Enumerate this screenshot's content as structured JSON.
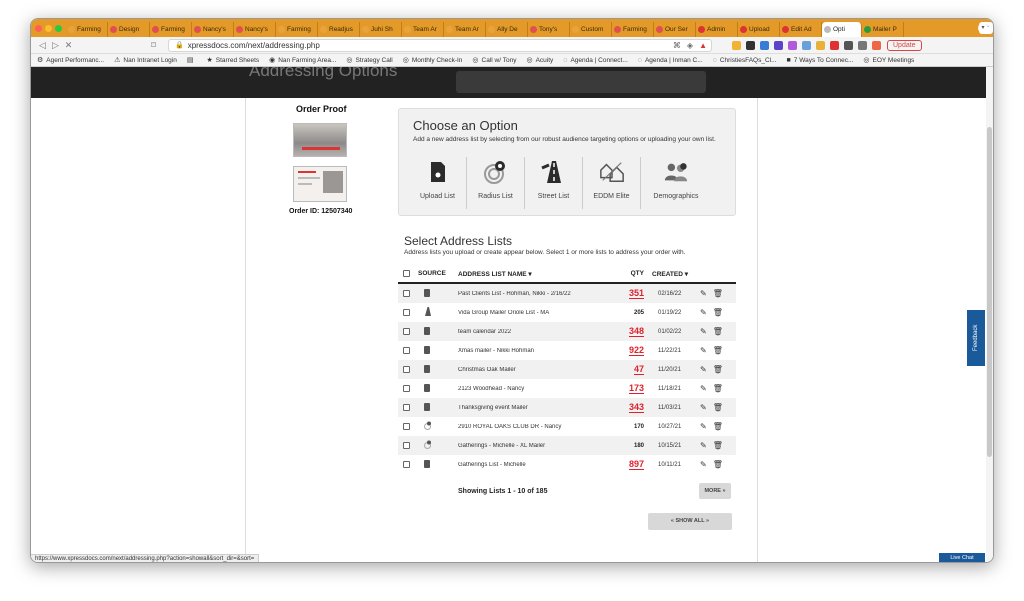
{
  "browser": {
    "tabs": [
      {
        "label": "Farming",
        "color": "#e8a33a"
      },
      {
        "label": "Design",
        "color": "#e05050"
      },
      {
        "label": "Farming",
        "color": "#e05050"
      },
      {
        "label": "Nancy's",
        "color": "#e05050"
      },
      {
        "label": "Nancy's",
        "color": "#e05050"
      },
      {
        "label": "Farming",
        "color": "#e8a33a"
      },
      {
        "label": "Readjus",
        "color": "#e8a33a"
      },
      {
        "label": "Juhi Sh",
        "color": "#e8a33a"
      },
      {
        "label": "Team Ar",
        "color": "#e8a33a"
      },
      {
        "label": "Team Ar",
        "color": "#e8a33a"
      },
      {
        "label": "Ally De",
        "color": "#e8a33a"
      },
      {
        "label": "Tony's",
        "color": "#e05050"
      },
      {
        "label": "Custom",
        "color": "#e8a33a"
      },
      {
        "label": "Farming",
        "color": "#e05050"
      },
      {
        "label": "Our Ser",
        "color": "#e05050"
      },
      {
        "label": "Admin",
        "color": "#d33"
      },
      {
        "label": "Upload",
        "color": "#d33"
      },
      {
        "label": "Edit Ad",
        "color": "#d33"
      },
      {
        "label": "Opti",
        "color": "#bbb"
      },
      {
        "label": "Mailer P",
        "color": "#2a9a3a"
      }
    ],
    "url": "xpressdocs.com/next/addressing.php",
    "update_label": "Update",
    "bookmarks": [
      {
        "label": "Agent Performanc...",
        "icon": "⚙"
      },
      {
        "label": "Nan Intranet Login",
        "icon": "⚠"
      },
      {
        "label": "",
        "icon": "▤"
      },
      {
        "label": "Starred Sheets",
        "icon": "★"
      },
      {
        "label": "Nan Farming Area...",
        "icon": "◉"
      },
      {
        "label": "Strategy Call",
        "icon": "◎"
      },
      {
        "label": "Monthly Check-In",
        "icon": "◎"
      },
      {
        "label": "Call w/ Tony",
        "icon": "◎"
      },
      {
        "label": "Acuity",
        "icon": "◎"
      },
      {
        "label": "Agenda | Connect...",
        "icon": "◌"
      },
      {
        "label": "Agenda | Inman C...",
        "icon": "◌"
      },
      {
        "label": "ChristiesFAQs_Cl...",
        "icon": "◌"
      },
      {
        "label": "7 Ways To Connec...",
        "icon": "■"
      },
      {
        "label": "EOY Meetings",
        "icon": "◎"
      }
    ]
  },
  "header": {
    "title": "Addressing Options"
  },
  "proof": {
    "title": "Order Proof",
    "order_id": "Order ID: 12507340"
  },
  "options": {
    "title": "Choose an Option",
    "subtitle": "Add a new address list by selecting from our robust audience targeting options or uploading your own list.",
    "items": [
      {
        "label": "Upload List",
        "icon": "upload-doc-icon"
      },
      {
        "label": "Radius List",
        "icon": "radius-target-icon"
      },
      {
        "label": "Street List",
        "icon": "street-road-icon"
      },
      {
        "label": "EDDM Elite",
        "icon": "eddm-houses-icon"
      },
      {
        "label": "Demographics",
        "icon": "demographics-people-icon"
      }
    ]
  },
  "lists": {
    "title": "Select Address Lists",
    "subtitle": "Address lists you upload or create appear below. Select 1 or more lists to address your order with.",
    "columns": {
      "source": "SOURCE",
      "name": "ADDRESS LIST NAME ▾",
      "qty": "QTY",
      "created": "CREATED ▾"
    },
    "rows": [
      {
        "source": "upload",
        "name": "Past Clients List - Hohman, Nikki - 2/16/22",
        "qty": "351",
        "qty_link": true,
        "created": "02/16/22"
      },
      {
        "source": "street",
        "name": "Vida Group Mailer Oriole List - MA",
        "qty": "205",
        "qty_link": false,
        "created": "01/19/22"
      },
      {
        "source": "upload",
        "name": "team calendar 2022",
        "qty": "348",
        "qty_link": true,
        "created": "01/02/22"
      },
      {
        "source": "upload",
        "name": "Xmas mailer - Nikki Hohman",
        "qty": "922",
        "qty_link": true,
        "created": "11/22/21"
      },
      {
        "source": "upload",
        "name": "Christmas Oak Mailer",
        "qty": "47",
        "qty_link": true,
        "created": "11/20/21"
      },
      {
        "source": "upload",
        "name": "2123 Woodhead - Nancy",
        "qty": "173",
        "qty_link": true,
        "created": "11/18/21"
      },
      {
        "source": "upload",
        "name": "Thanksgiving event Mailer",
        "qty": "343",
        "qty_link": true,
        "created": "11/03/21"
      },
      {
        "source": "radius",
        "name": "2910 ROYAL OAKS CLUB DR - Nancy",
        "qty": "170",
        "qty_link": false,
        "created": "10/27/21"
      },
      {
        "source": "radius",
        "name": "Gatherings - Michelle - XL Mailer",
        "qty": "180",
        "qty_link": false,
        "created": "10/15/21"
      },
      {
        "source": "upload",
        "name": "Gatherings List - Michelle",
        "qty": "897",
        "qty_link": true,
        "created": "10/11/21"
      }
    ],
    "showing": "Showing Lists 1 - 10 of 185",
    "more_label": "MORE »",
    "show_all_label": "« SHOW ALL »"
  },
  "feedback_label": "Feedback",
  "live_chat_label": "Live Chat",
  "status_url": "https://www.xpressdocs.com/next/addressing.php?action=showall&sort_dir=&sort=",
  "colors": {
    "accent_red": "#e0202c",
    "brand_blue": "#1a5a9a",
    "tab_orange": "#e49a28"
  }
}
